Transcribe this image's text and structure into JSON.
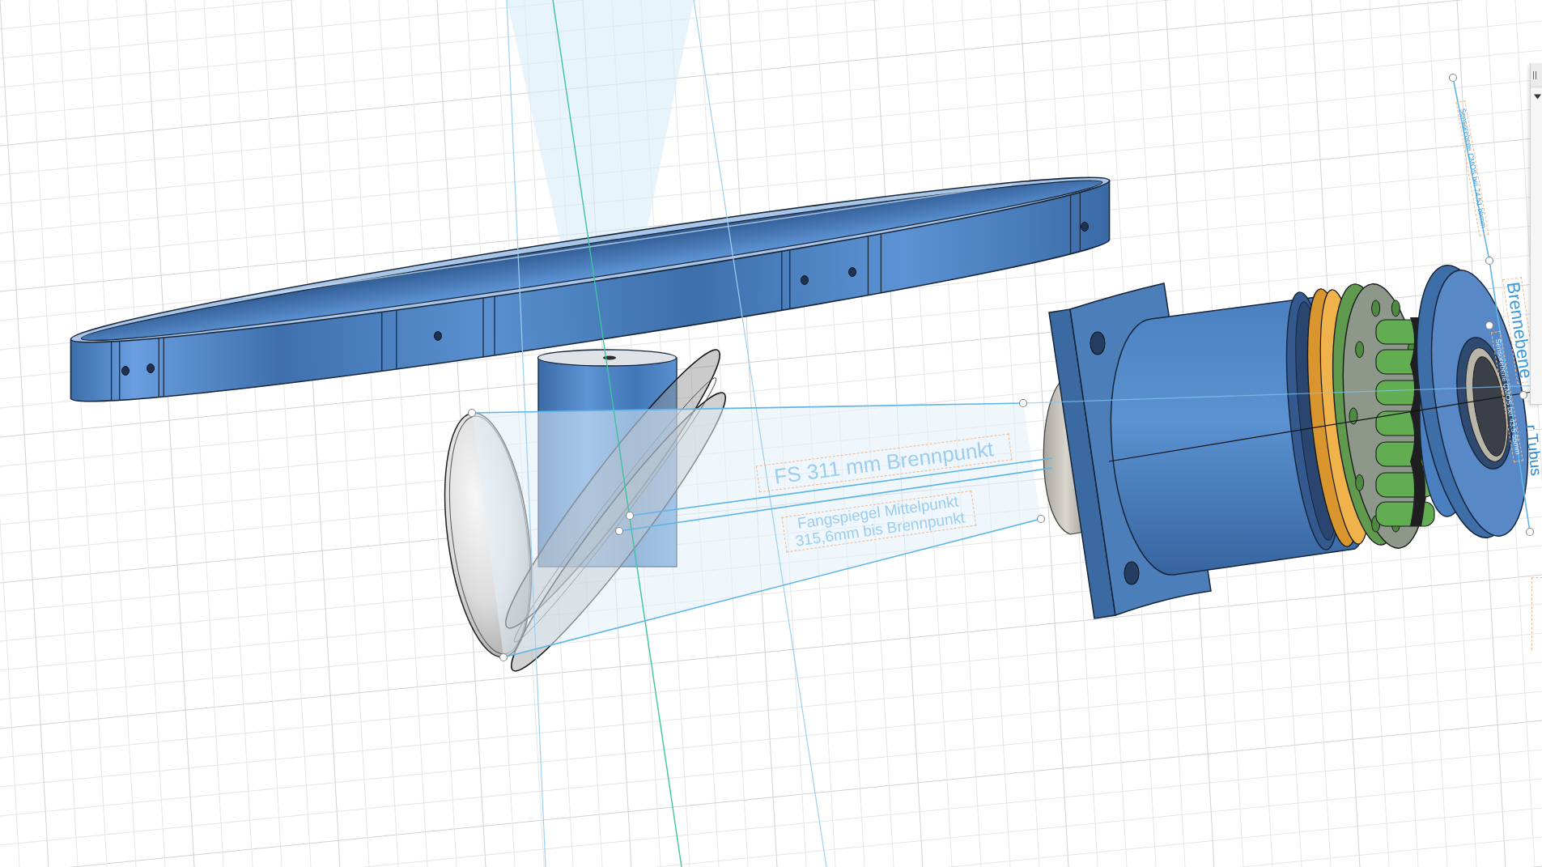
{
  "viewport": {
    "annotations": [
      {
        "lines": [
          "FS 311 mm Brennpunkt"
        ]
      },
      {
        "lines": [
          "Fangspiegel Mittelpunkt",
          "315,6mm bis Brennpunkt"
        ]
      }
    ],
    "side_annotations": [
      {
        "text": "Sensorebene CMOS bei 74,51 bbmm"
      },
      {
        "text": "Brennebene"
      },
      {
        "text": "Sensorebene CMOS bei 43,5 55mm"
      },
      {
        "text": "r Tubus"
      }
    ]
  },
  "browser_panel": {
    "expanded": true
  }
}
